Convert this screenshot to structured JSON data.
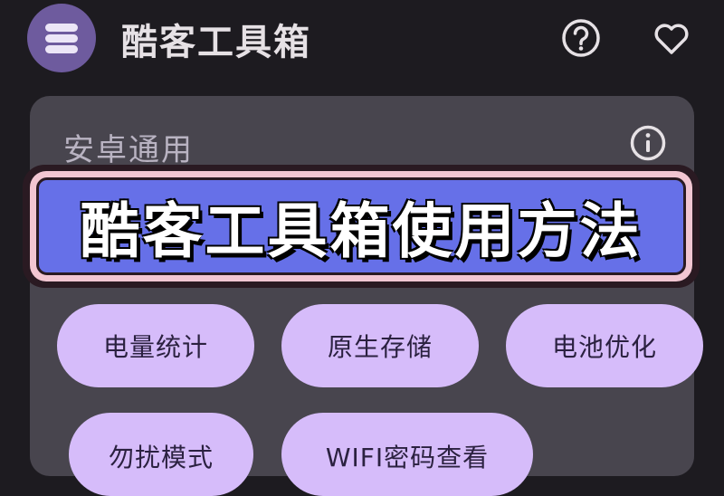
{
  "app_bar": {
    "title": "酷客工具箱",
    "help_icon": "help-circle-icon",
    "favorite_icon": "heart-outline-icon",
    "logo_icon": "stacked-layers-icon"
  },
  "section": {
    "title": "安卓通用",
    "info_icon": "info-circle-icon"
  },
  "banner": {
    "text": "酷客工具箱使用方法"
  },
  "chips": [
    {
      "label": "电量统计"
    },
    {
      "label": "原生存储"
    },
    {
      "label": "电池优化"
    },
    {
      "label": "勿扰模式"
    },
    {
      "label": "WIFI密码查看"
    }
  ],
  "colors": {
    "background": "#1d1b20",
    "card": "#48454e",
    "chip": "#d6bcfa",
    "banner": "#6670e8",
    "banner_border": "#f2c6d2"
  }
}
